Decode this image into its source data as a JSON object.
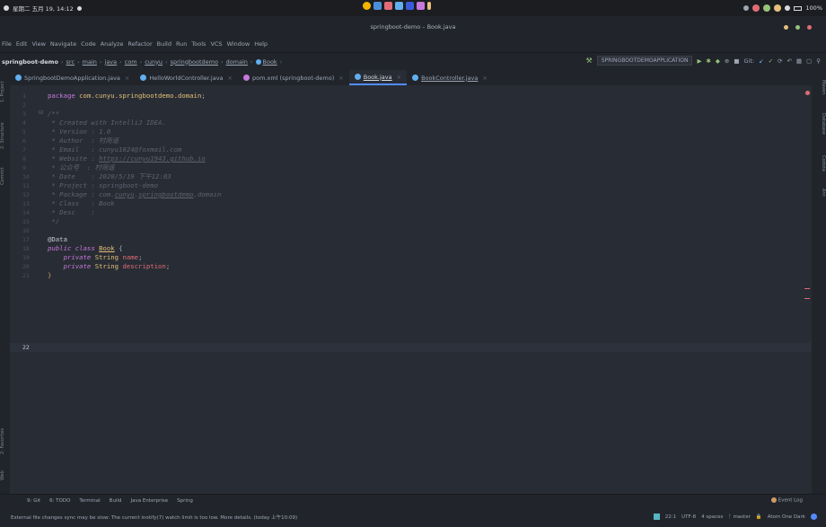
{
  "system": {
    "datetime": "星期二 五月 19, 14:12",
    "battery": "100%"
  },
  "window": {
    "title": "springboot-demo – Book.java"
  },
  "menu": [
    "File",
    "Edit",
    "View",
    "Navigate",
    "Code",
    "Analyze",
    "Refactor",
    "Build",
    "Run",
    "Tools",
    "VCS",
    "Window",
    "Help"
  ],
  "breadcrumb": [
    "springboot-demo",
    "src",
    "main",
    "java",
    "com",
    "cunyu",
    "springbootdemo",
    "domain",
    "Book"
  ],
  "toolbar": {
    "run_config": "SPRINGBOOTDEMOAPPLICATION",
    "git_label": "Git:"
  },
  "tabs": [
    {
      "label": "SpringbootDemoApplication.java",
      "icon_color": "#61afef",
      "active": false
    },
    {
      "label": "HelloWorldController.java",
      "icon_color": "#61afef",
      "active": false
    },
    {
      "label": "pom.xml (springboot-demo)",
      "icon_color": "#c678dd",
      "active": false
    },
    {
      "label": "Book.java",
      "icon_color": "#61afef",
      "active": true
    },
    {
      "label": "BookController.java",
      "icon_color": "#61afef",
      "active": false
    }
  ],
  "left_tools": [
    "1: Project",
    "2: Structure",
    "Commit",
    "2: Favorites",
    "Web"
  ],
  "right_tools": [
    "Maven",
    "Database",
    "Codota",
    "Ant"
  ],
  "code": {
    "line_numbers": [
      "1",
      "2",
      "3",
      "4",
      "5",
      "6",
      "7",
      "8",
      "9",
      "10",
      "11",
      "12",
      "13",
      "14",
      "15",
      "16",
      "17",
      "18",
      "19",
      "20",
      "21",
      "22"
    ],
    "l1_kw": "package ",
    "l1_pkg": "com.cunyu.springbootdemo.domain",
    "l1_end": ";",
    "l3": "/**",
    "l4": " * Created with IntelliJ IDEA.",
    "l5": " * Version : 1.0",
    "l6": " * Author  : 村雨遥",
    "l7": " * Email   : cunyu1024@foxmail.com",
    "l8_pre": " * Website : ",
    "l8_link": "https://cunyu1943.github.io",
    "l9": " * 公众号  : 村雨遥",
    "l10": " * Date    : 2020/5/19 下午12:03",
    "l11": " * Project : springboot-demo",
    "l12_pre": " * Package : com.",
    "l12_u1": "cunyu",
    "l12_mid": ".",
    "l12_u2": "springbootdemo",
    "l12_end": ".domain",
    "l13": " * Class   : Book",
    "l14": " * Desc    :",
    "l15": " */",
    "l17": "@Data",
    "l18_kw": "public class ",
    "l18_cls": "Book",
    "l18_end": " {",
    "l19_kw": "    private ",
    "l19_type": "String ",
    "l19_fld": "name",
    "l19_end": ";",
    "l20_kw": "    private ",
    "l20_type": "String ",
    "l20_fld": "description",
    "l20_end": ";",
    "l21": "}"
  },
  "bottom_tools": [
    "9: Git",
    "6: TODO",
    "Terminal",
    "Build",
    "Java Enterprise",
    "Spring"
  ],
  "event_log": "Event Log",
  "status": {
    "message": "External file changes sync may be slow: The current inotify(7) watch limit is too low. More details. (today 上午10:09)",
    "position": "22:1",
    "encoding": "UTF-8",
    "indent": "4 spaces",
    "branch": "master",
    "theme": "Atom One Dark"
  },
  "colors": {
    "accent": "#528bff",
    "background": "#282c34",
    "panel": "#21252b"
  }
}
